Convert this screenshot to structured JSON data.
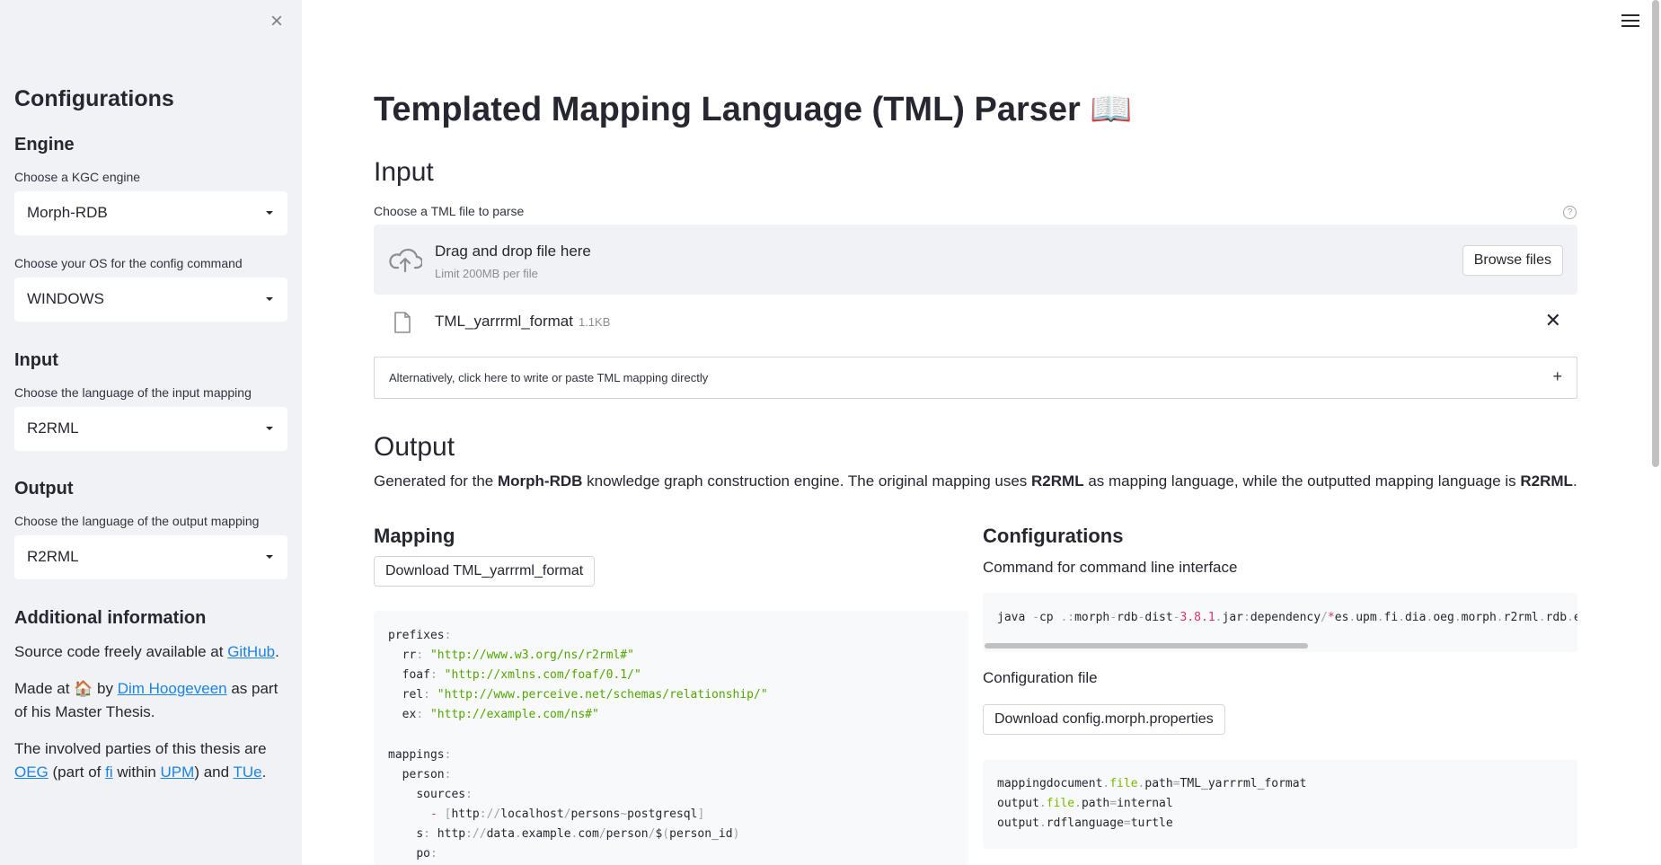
{
  "sidebar": {
    "close_icon": "close-icon",
    "heading": "Configurations",
    "engine": {
      "heading": "Engine",
      "label": "Choose a KGC engine",
      "value": "Morph-RDB"
    },
    "os": {
      "label": "Choose your OS for the config command",
      "value": "WINDOWS"
    },
    "input": {
      "heading": "Input",
      "label": "Choose the language of the input mapping",
      "value": "R2RML"
    },
    "output": {
      "heading": "Output",
      "label": "Choose the language of the output mapping",
      "value": "R2RML"
    },
    "info": {
      "heading": "Additional information",
      "source_prefix": "Source code freely available at ",
      "source_link": "GitHub",
      "source_suffix": ".",
      "made_prefix": "Made at 🏠 by ",
      "made_link": "Dim Hoogeveen",
      "made_suffix": " as part of his Master Thesis.",
      "parties_prefix": "The involved parties of this thesis are ",
      "parties_link1": "OEG",
      "parties_mid1": " (part of ",
      "parties_link2": "fi",
      "parties_mid2": " within ",
      "parties_link3": "UPM",
      "parties_mid3": ") and ",
      "parties_link4": "TUe",
      "parties_suffix": "."
    }
  },
  "main": {
    "menu_icon": "hamburger-menu-icon",
    "title": "Templated Mapping Language (TML) Parser 📖",
    "input_heading": "Input",
    "uploader": {
      "label": "Choose a TML file to parse",
      "help_icon": "help-circle-icon",
      "drop_title": "Drag and drop file here",
      "drop_limit": "Limit 200MB per file",
      "browse_label": "Browse files",
      "file_name": "TML_yarrrml_format",
      "file_size": "1.1KB"
    },
    "expander_label": "Alternatively, click here to write or paste TML mapping directly",
    "expander_icon": "+",
    "output_heading": "Output",
    "output_desc": {
      "prefix": "Generated for the ",
      "engine": "Morph-RDB",
      "mid1": " knowledge graph construction engine. The original mapping uses ",
      "in_lang": "R2RML",
      "mid2": " as mapping language, while the outputted mapping language is ",
      "out_lang": "R2RML",
      "suffix": "."
    },
    "mapping": {
      "heading": "Mapping",
      "download_label": "Download TML_yarrrml_format"
    },
    "config": {
      "heading": "Configurations",
      "cli_label": "Command for command line interface",
      "file_label": "Configuration file",
      "download_label": "Download config.morph.properties"
    }
  },
  "colors": {
    "accent_link": "#1c83e1",
    "sidebar_bg": "#f0f2f6",
    "string_green": "#52a500"
  }
}
